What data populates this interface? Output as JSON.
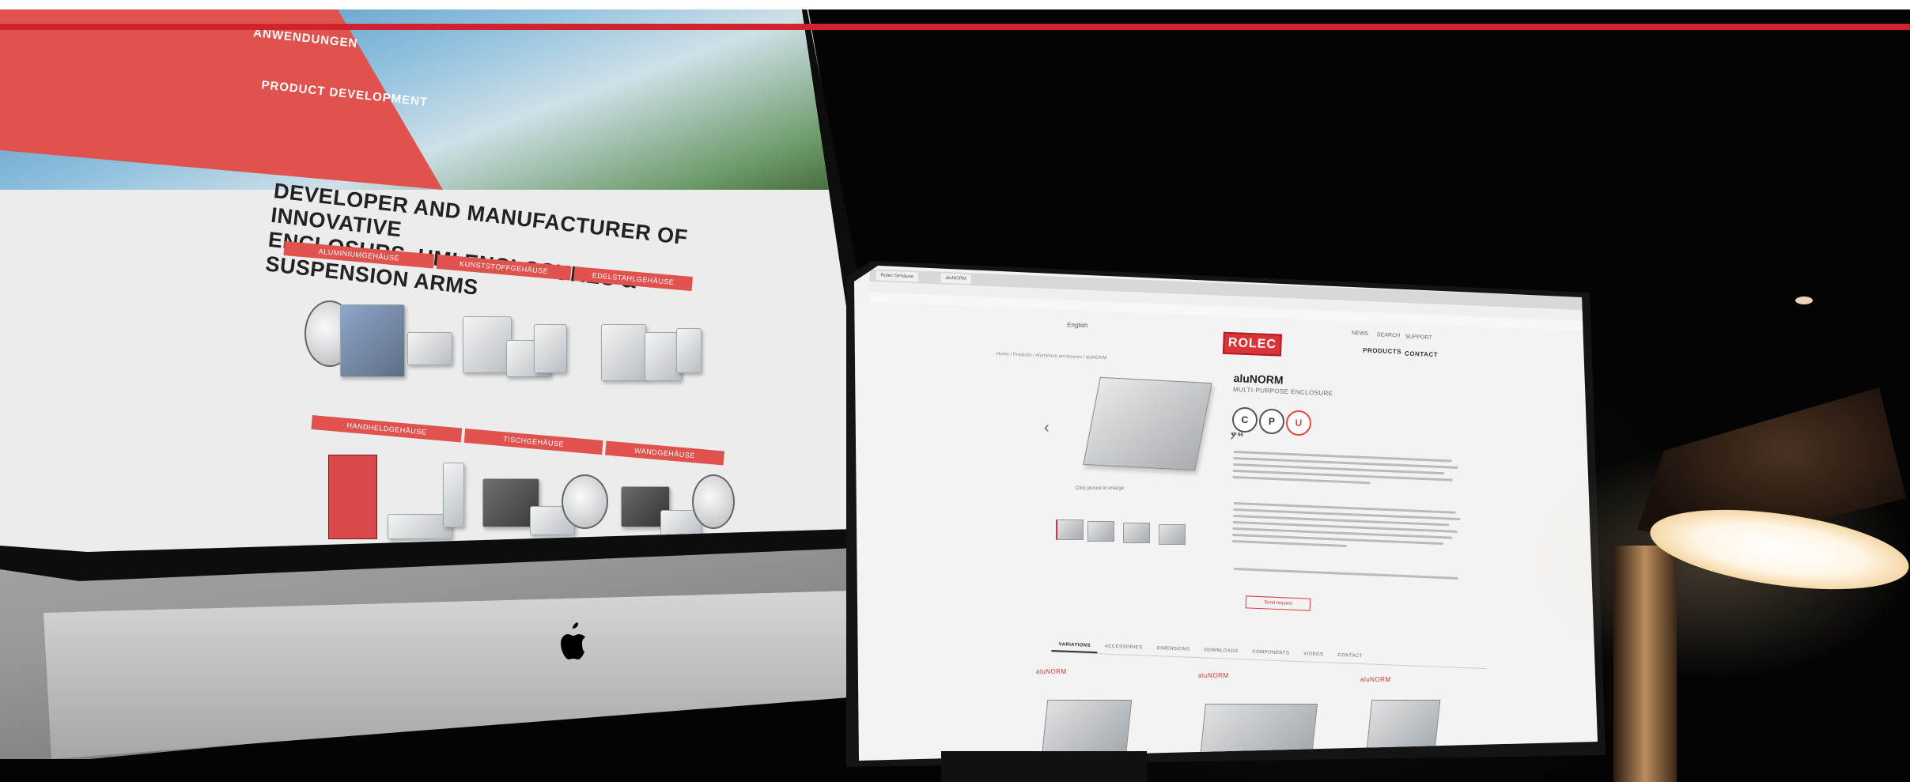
{
  "imac_site": {
    "hero_links": [
      "ANWENDUNGEN",
      "PRODUCT DEVELOPMENT"
    ],
    "headline_line1": "DEVELOPER AND MANUFACTURER OF INNOVATIVE",
    "headline_line2": "ENCLOSURS, HMI ENCLOSURES & SUSPENSION ARMS",
    "categories_row1": [
      "ALUMINIUMGEHÄUSE",
      "KUNSTSTOFFGEHÄUSE",
      "EDELSTAHLGEHÄUSE"
    ],
    "categories_row2": [
      "HANDHELDGEHÄUSE",
      "TISCHGEHÄUSE",
      "WANDGEHÄUSE"
    ]
  },
  "monitor_site": {
    "tabs": [
      "Rolec Gehäuse",
      "aluNORM"
    ],
    "language": "English",
    "logo_text": "ROLEC",
    "top_links": [
      "NEWS",
      "SEARCH",
      "SUPPORT"
    ],
    "nav_items": [
      "PRODUCTS",
      "CONTACT"
    ],
    "breadcrumb": "Home / Products / Aluminium enclosures / aluNORM",
    "product_name": "aluNORM",
    "product_subtitle": "MULTI-PURPOSE ENCLOSURE",
    "rating_label": "IP 66",
    "image_caption": "Click picture to enlarge",
    "request_button": "Send request",
    "detail_tabs": [
      "VARIATIONS",
      "ACCESSORIES",
      "DIMENSIONS",
      "DOWNLOADS",
      "COMPONENTS",
      "VIDEOS",
      "CONTACT"
    ],
    "variation_labels": [
      "aluNORM",
      "aluNORM",
      "aluNORM"
    ]
  },
  "colors": {
    "brand_red": "#d8343a",
    "top_rule": "#d0232d"
  }
}
